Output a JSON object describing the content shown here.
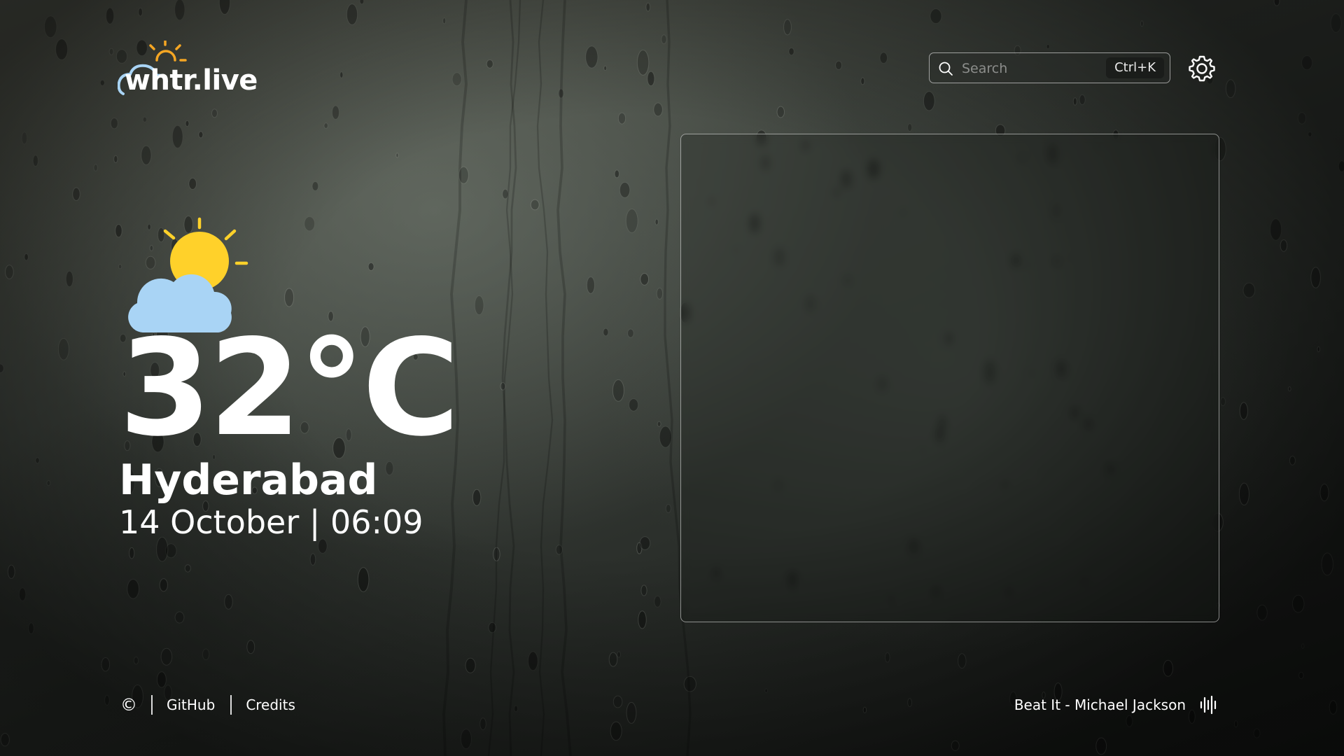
{
  "brand": {
    "logo_text": "whtr.live"
  },
  "header": {
    "search": {
      "placeholder": "Search",
      "value": "",
      "shortcut": "Ctrl+K",
      "icon": "search-icon"
    },
    "settings_icon": "gear-icon"
  },
  "weather": {
    "condition_icon": "partly-cloudy-icon",
    "temperature": "32°C",
    "city": "Hyderabad",
    "datetime": "14 October | 06:09"
  },
  "footer": {
    "copyright_symbol": "©",
    "links": [
      "GitHub",
      "Credits"
    ],
    "now_playing": "Beat It - Michael Jackson",
    "now_playing_icon": "audio-equalizer-icon"
  },
  "colors": {
    "text": "#ffffff",
    "sun": "#ffd12a",
    "cloud": "#a9d4f5",
    "logo_sun": "#f5a623"
  }
}
